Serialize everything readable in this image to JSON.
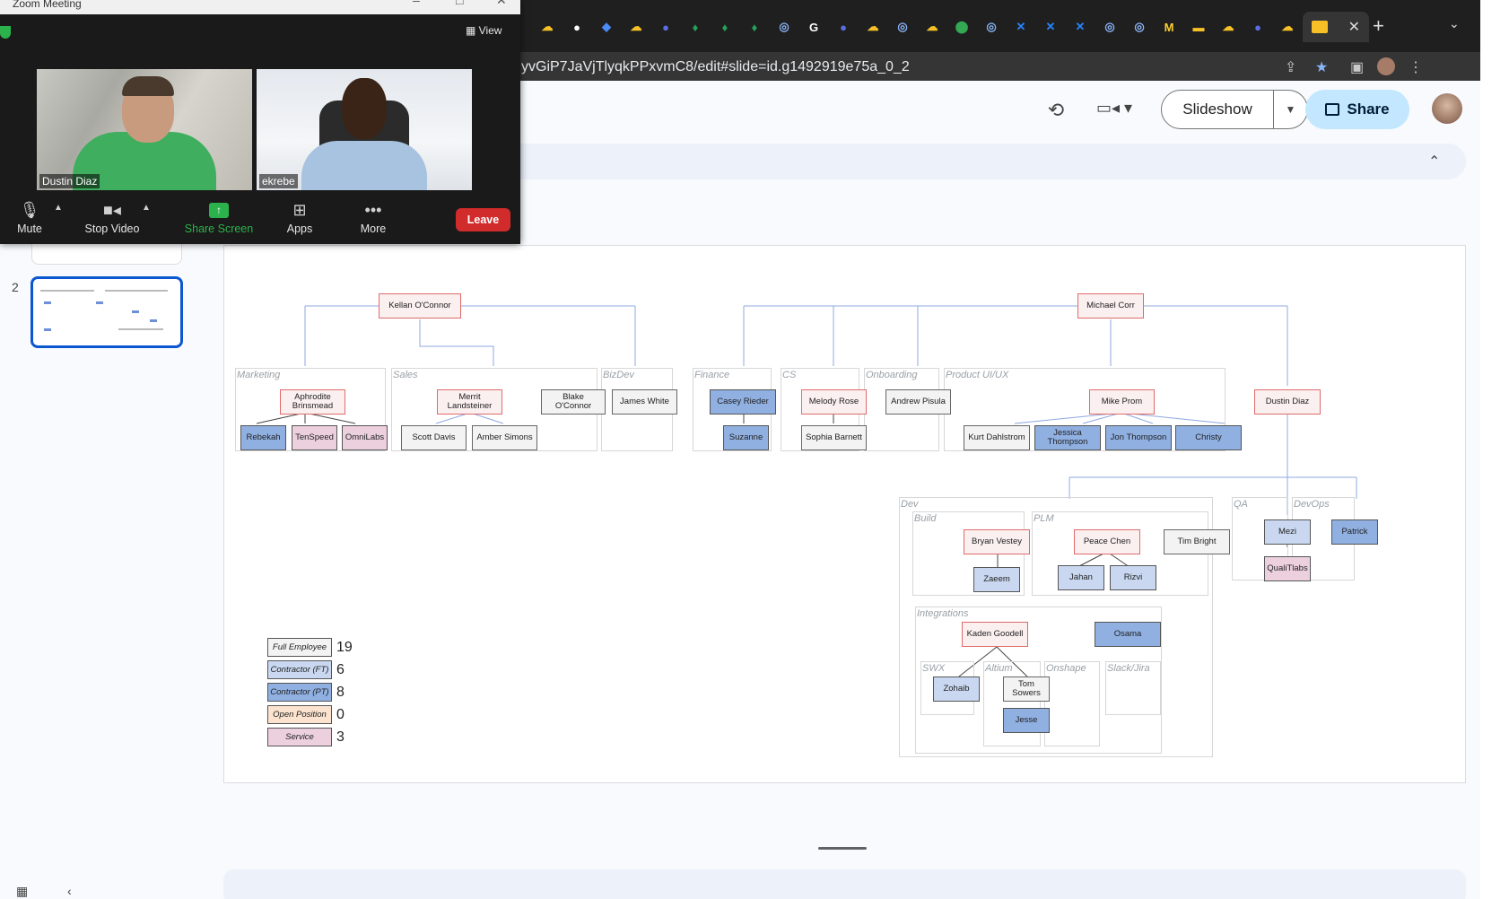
{
  "browser": {
    "url": "yvGiP7JaVjTlyqkPPxvmC8/edit#slide=id.g1492919e75a_0_2",
    "tab_icons": [
      "cloud-icon",
      "github-icon",
      "jira-icon",
      "cloud-icon",
      "circle-icon",
      "leaf-icon",
      "leaf-icon",
      "leaf-icon",
      "chrome-icon",
      "google-icon",
      "circle-icon",
      "cloud-icon",
      "chrome-icon",
      "cloud-icon",
      "maps-icon",
      "chrome-icon",
      "confluence-icon",
      "confluence-icon",
      "confluence-icon",
      "chrome-icon",
      "chrome-icon",
      "miro-icon",
      "slides-icon",
      "cloud-icon",
      "circle-icon",
      "cloud-icon"
    ],
    "tab_icon_colors": [
      "#f6c026",
      "#ffffff",
      "#4c8bf5",
      "#f6c026",
      "#5b6ee1",
      "#25a35a",
      "#25a35a",
      "#25a35a",
      "#8ab4f8",
      "#ffffff",
      "#5b6ee1",
      "#f6c026",
      "#8ab4f8",
      "#f6c026",
      "#34a853",
      "#8ab4f8",
      "#2684ff",
      "#2684ff",
      "#2684ff",
      "#8ab4f8",
      "#8ab4f8",
      "#ffd02f",
      "#f6c026",
      "#f6c026",
      "#5b6ee1",
      "#f6c026"
    ],
    "new_tab_label": "+"
  },
  "slides_toolbar": {
    "slideshow_label": "Slideshow",
    "share_label": "Share"
  },
  "filmstrip": {
    "slide_number": "2"
  },
  "org": {
    "top_left": "Kellan O'Connor",
    "top_right": "Michael Corr",
    "groups": {
      "marketing": "Marketing",
      "sales": "Sales",
      "bizdev": "BizDev",
      "finance": "Finance",
      "cs": "CS",
      "onboarding": "Onboarding",
      "product": "Product UI/UX",
      "dev": "Dev",
      "build": "Build",
      "plm": "PLM",
      "integrations": "Integrations",
      "swx": "SWX",
      "altium": "Altium",
      "onshape": "Onshape",
      "slack": "Slack/Jira",
      "qa": "QA",
      "devops": "DevOps"
    },
    "people": {
      "aphrodite": "Aphrodite Brinsmead",
      "rebekah": "Rebekah",
      "tenspeed": "TenSpeed",
      "omnilabs": "OmniLabs",
      "merrit": "Merrit Landsteiner",
      "blake": "Blake O'Connor",
      "scott": "Scott Davis",
      "amber": "Amber Simons",
      "james": "James White",
      "casey": "Casey Rieder",
      "suzanne": "Suzanne",
      "melody": "Melody Rose",
      "sophia": "Sophia Barnett",
      "andrew": "Andrew Pisula",
      "mike": "Mike Prom",
      "kurt": "Kurt Dahlstrom",
      "jessica": "Jessica Thompson",
      "jon": "Jon Thompson",
      "christy": "Christy",
      "dustin": "Dustin Diaz",
      "bryan": "Bryan Vestey",
      "zaeem": "Zaeem",
      "peace": "Peace Chen",
      "tim": "Tim Bright",
      "jahan": "Jahan",
      "rizvi": "Rizvi",
      "kaden": "Kaden Goodell",
      "osama": "Osama",
      "zohaib": "Zohaib",
      "tom": "Tom Sowers",
      "jesse": "Jesse",
      "mezi": "Mezi",
      "qualitlabs": "QualiTlabs",
      "patrick": "Patrick"
    }
  },
  "legend": [
    {
      "label": "Full Employee",
      "count": "19",
      "color": "#f3f3f3"
    },
    {
      "label": "Contractor (FT)",
      "count": "6",
      "color": "#c9d8f0"
    },
    {
      "label": "Contractor (PT)",
      "count": "8",
      "color": "#90b0e2"
    },
    {
      "label": "Open Position",
      "count": "0",
      "color": "#fbe3cf"
    },
    {
      "label": "Service",
      "count": "3",
      "color": "#ecd0de"
    }
  ],
  "zoom": {
    "title": "Zoom Meeting",
    "view_label": "View",
    "participants": [
      "Dustin Diaz",
      "ekrebe"
    ],
    "controls": {
      "mute": "Mute",
      "stop_video": "Stop Video",
      "share_screen": "Share Screen",
      "apps": "Apps",
      "more": "More",
      "leave": "Leave"
    }
  }
}
